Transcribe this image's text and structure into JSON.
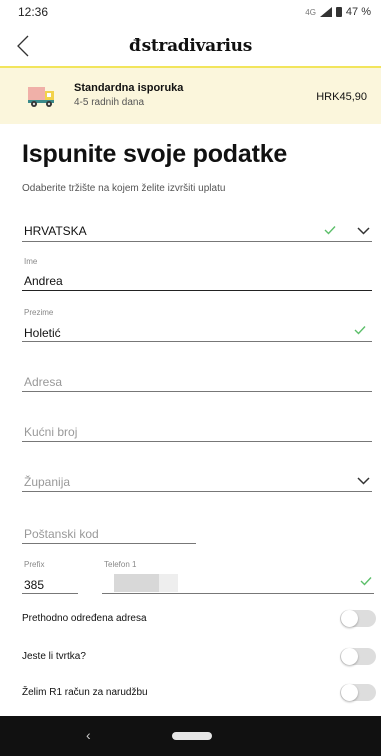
{
  "status_bar": {
    "time": "12:36",
    "network": "4G",
    "battery": "47 %"
  },
  "header": {
    "brand": "stradivarius",
    "brand_mark": "đ"
  },
  "shipping": {
    "title": "Standardna isporuka",
    "subtitle": "4-5 radnih dana",
    "price": "HRK45,90"
  },
  "form": {
    "title": "Ispunite svoje podatke",
    "subtitle": "Odaberite tržište na kojem želite izvršiti uplatu",
    "country": {
      "value": "HRVATSKA"
    },
    "first_name": {
      "label": "Ime",
      "value": "Andrea"
    },
    "last_name": {
      "label": "Prezime",
      "value": "Holetić"
    },
    "address": {
      "placeholder": "Adresa"
    },
    "house_number": {
      "placeholder": "Kućni broj"
    },
    "county": {
      "placeholder": "Županija"
    },
    "postal_code": {
      "placeholder": "Poštanski kod"
    },
    "prefix": {
      "label": "Prefix",
      "value": "385"
    },
    "phone": {
      "label": "Telefon 1",
      "value": ""
    }
  },
  "toggles": [
    {
      "label": "Prethodno određena adresa",
      "on": false
    },
    {
      "label": "Jeste li tvrtka?",
      "on": false
    },
    {
      "label": "Želim R1 račun za narudžbu",
      "on": false
    }
  ],
  "colors": {
    "accent_yellow": "#f2e55c",
    "banner_bg": "#fbf6dc",
    "check_green": "#5cbf6a"
  },
  "icons": {
    "back": "chevron-left-icon",
    "truck": "truck-icon",
    "check": "check-icon",
    "dropdown": "chevron-down-icon"
  }
}
